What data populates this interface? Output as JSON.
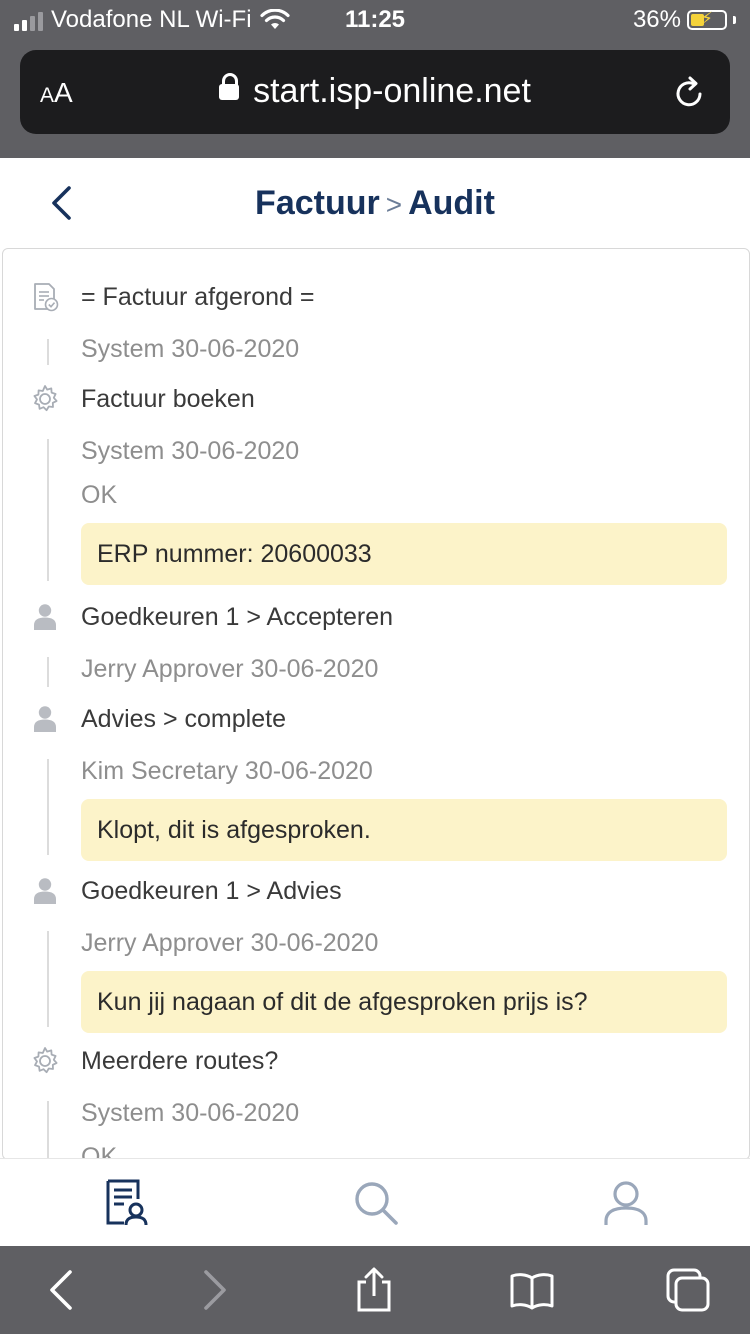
{
  "status_bar": {
    "carrier": "Vodafone NL Wi-Fi",
    "time": "11:25",
    "battery": "36%",
    "battery_level": 0.36
  },
  "browser": {
    "text_size_label_small": "A",
    "text_size_label_large": "A",
    "url": "start.isp-online.net"
  },
  "header": {
    "crumb_parent": "Factuur",
    "crumb_separator": ">",
    "crumb_current": "Audit"
  },
  "audit": [
    {
      "icon": "document-check-icon",
      "title": "= Factuur afgerond =",
      "meta": "System 30-06-2020",
      "result": "",
      "note": ""
    },
    {
      "icon": "gear-icon",
      "title": "Factuur boeken",
      "meta": "System 30-06-2020",
      "result": "OK",
      "note": "ERP nummer: 20600033"
    },
    {
      "icon": "person-icon",
      "title": "Goedkeuren 1 > Accepteren",
      "meta": "Jerry Approver 30-06-2020",
      "result": "",
      "note": ""
    },
    {
      "icon": "person-icon",
      "title": "Advies > complete",
      "meta": "Kim Secretary 30-06-2020",
      "result": "",
      "note": "Klopt, dit is afgesproken."
    },
    {
      "icon": "person-icon",
      "title": "Goedkeuren 1 > Advies",
      "meta": "Jerry Approver 30-06-2020",
      "result": "",
      "note": "Kun jij nagaan of dit de afgesproken prijs is?"
    },
    {
      "icon": "gear-icon",
      "title": "Meerdere routes?",
      "meta": "System 30-06-2020",
      "result": "OK",
      "note": ""
    }
  ],
  "tabbar": {
    "items": [
      "invoices-tab",
      "search-tab",
      "profile-tab"
    ],
    "active": "invoices-tab",
    "active_color": "#17325c",
    "inactive_color": "#9aa7ba"
  }
}
